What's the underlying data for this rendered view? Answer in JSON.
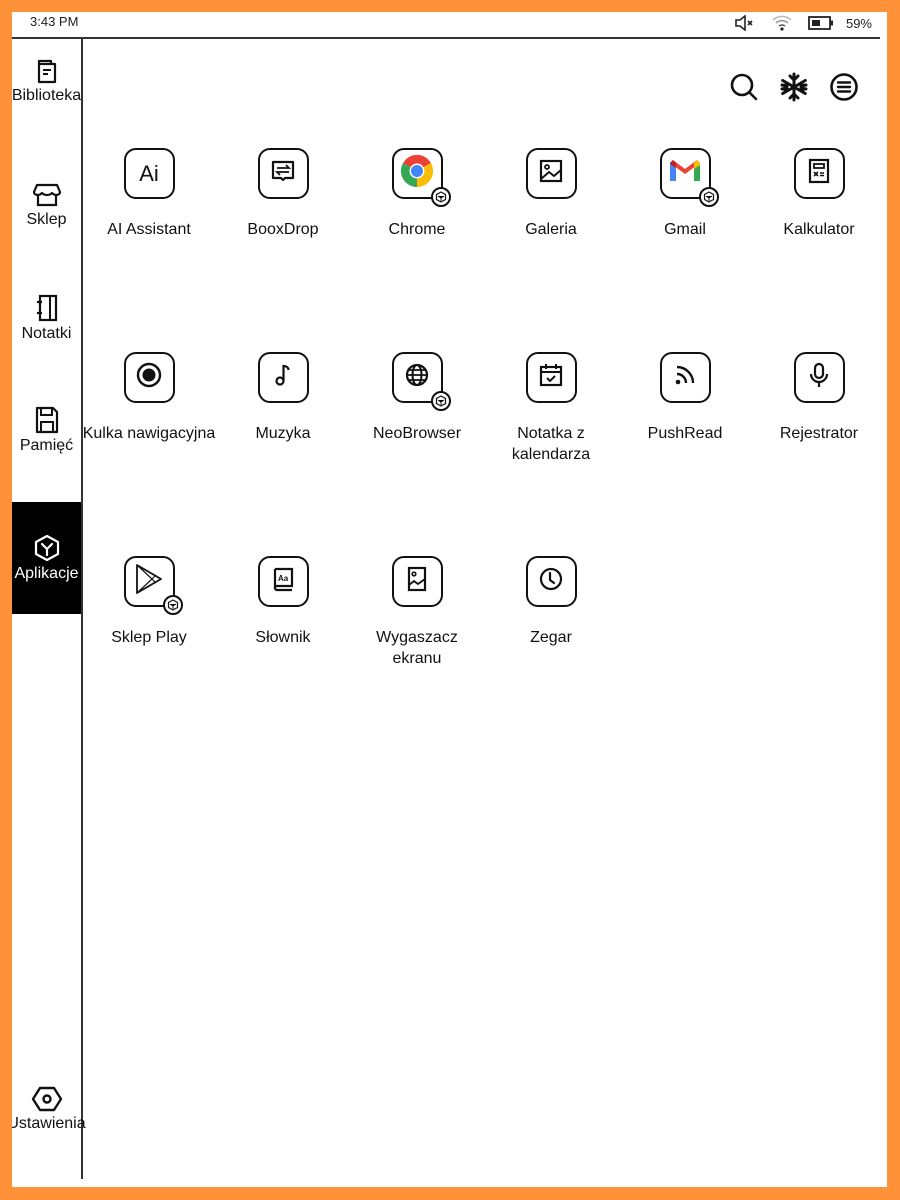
{
  "status_bar": {
    "time": "3:43 PM",
    "icons": [
      "volume-muted-icon",
      "wifi-icon",
      "battery-icon"
    ],
    "battery_percent": "59%"
  },
  "sidebar": {
    "items": [
      {
        "label": "Biblioteka",
        "icon": "library-icon",
        "active": false
      },
      {
        "label": "Sklep",
        "icon": "store-icon",
        "active": false
      },
      {
        "label": "Notatki",
        "icon": "notebook-icon",
        "active": false
      },
      {
        "label": "Pamięć",
        "icon": "storage-icon",
        "active": false
      },
      {
        "label": "Aplikacje",
        "icon": "apps-cube-icon",
        "active": true
      }
    ],
    "settings": {
      "label": "Ustawienia",
      "icon": "settings-hex-icon"
    }
  },
  "toolbar": {
    "buttons": [
      {
        "name": "search",
        "icon": "search-icon"
      },
      {
        "name": "freeze",
        "icon": "snowflake-icon"
      },
      {
        "name": "menu",
        "icon": "menu-circle-icon"
      }
    ]
  },
  "apps": [
    {
      "label": "AI Assistant",
      "icon": "ai-icon",
      "badge": false
    },
    {
      "label": "BooxDrop",
      "icon": "booxdrop-icon",
      "badge": false
    },
    {
      "label": "Chrome",
      "icon": "chrome-icon",
      "badge": true
    },
    {
      "label": "Galeria",
      "icon": "gallery-icon",
      "badge": false
    },
    {
      "label": "Gmail",
      "icon": "gmail-icon",
      "badge": true
    },
    {
      "label": "Kalkulator",
      "icon": "calculator-icon",
      "badge": false
    },
    {
      "label": "Kulka nawigacyjna",
      "icon": "navigation-ball-icon",
      "badge": false
    },
    {
      "label": "Muzyka",
      "icon": "music-note-icon",
      "badge": false
    },
    {
      "label": "NeoBrowser",
      "icon": "globe-icon",
      "badge": true
    },
    {
      "label": "Notatka z kalendarza",
      "icon": "calendar-check-icon",
      "badge": false
    },
    {
      "label": "PushRead",
      "icon": "rss-icon",
      "badge": false
    },
    {
      "label": "Rejestrator",
      "icon": "microphone-icon",
      "badge": false
    },
    {
      "label": "Sklep Play",
      "icon": "play-store-icon",
      "badge": true
    },
    {
      "label": "Słownik",
      "icon": "dictionary-icon",
      "badge": false
    },
    {
      "label": "Wygaszacz ekranu",
      "icon": "screensaver-icon",
      "badge": false
    },
    {
      "label": "Zegar",
      "icon": "clock-icon",
      "badge": false
    }
  ],
  "colors": {
    "frame": "#FF9138",
    "active_nav_bg": "#000000",
    "chrome_red": "#EA4335",
    "chrome_green": "#34A853",
    "chrome_yellow": "#FBBC05",
    "chrome_blue": "#4285F4"
  }
}
